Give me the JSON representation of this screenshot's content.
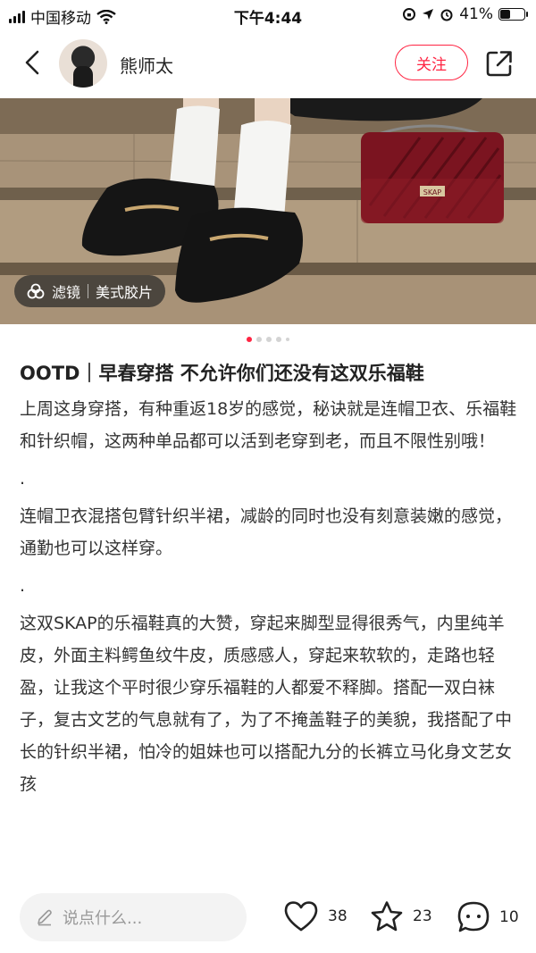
{
  "status_bar": {
    "carrier": "中国移动",
    "time": "下午4:44",
    "battery": "41%",
    "battery_level": 0.41
  },
  "header": {
    "username": "熊师太",
    "follow_label": "关注"
  },
  "photo": {
    "filter_label": "滤镜",
    "filter_name": "美式胶片",
    "bag_brand": "SKAP"
  },
  "post": {
    "title": "OOTD｜早春穿搭 不允许你们还没有这双乐福鞋",
    "paragraphs": [
      "上周这身穿搭，有种重返18岁的感觉，秘诀就是连帽卫衣、乐福鞋和针织帽，这两种单品都可以活到老穿到老，而且不限性别哦！",
      ".",
      "连帽卫衣混搭包臂针织半裙，减龄的同时也没有刻意装嫩的感觉，通勤也可以这样穿。",
      ".",
      "这双SKAP的乐福鞋真的大赞，穿起来脚型显得很秀气，内里纯羊皮，外面主料鳄鱼纹牛皮，质感感人，穿起来软软的，走路也轻盈，让我这个平时很少穿乐福鞋的人都爱不释脚。搭配一双白袜子，复古文艺的气息就有了，为了不掩盖鞋子的美貌，我搭配了中长的针织半裙，怕冷的姐妹也可以搭配九分的长裤立马化身文艺女孩"
    ]
  },
  "bottom_bar": {
    "comment_placeholder": "说点什么...",
    "likes": "38",
    "collects": "23",
    "comments": "10"
  },
  "colors": {
    "accent": "#ff2442",
    "text": "#222222"
  },
  "icons": [
    "back-arrow-icon",
    "share-icon",
    "filter-icon",
    "pencil-icon",
    "heart-icon",
    "star-icon",
    "comment-bubble-icon"
  ]
}
